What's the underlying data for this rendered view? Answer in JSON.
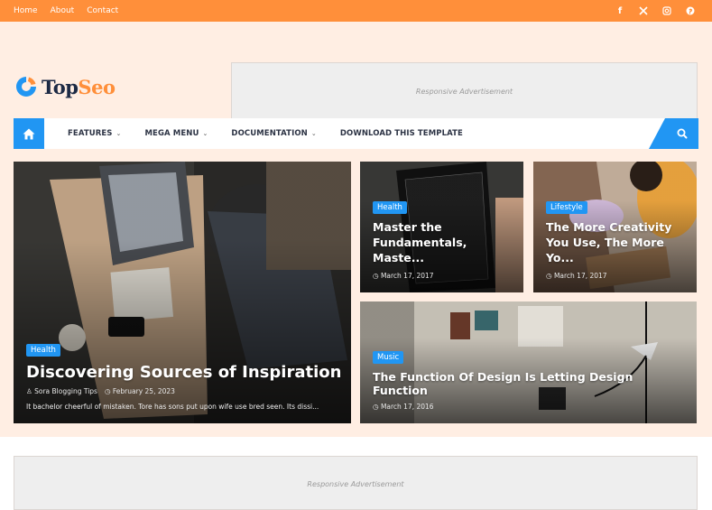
{
  "topbar": {
    "links": [
      {
        "label": "Home"
      },
      {
        "label": "About"
      },
      {
        "label": "Contact"
      }
    ],
    "social": [
      {
        "name": "facebook-icon",
        "glyph": "f"
      },
      {
        "name": "x-twitter-icon",
        "glyph": "𝕏"
      },
      {
        "name": "instagram-icon",
        "glyph": "◎"
      },
      {
        "name": "pinterest-icon",
        "glyph": "℗"
      }
    ]
  },
  "header": {
    "logo_part1": "Top",
    "logo_part2": "Seo",
    "ad_label": "Responsive Advertisement"
  },
  "nav": {
    "items": [
      {
        "label": "FEATURES",
        "has_dropdown": true
      },
      {
        "label": "MEGA MENU",
        "has_dropdown": true
      },
      {
        "label": "DOCUMENTATION",
        "has_dropdown": true
      },
      {
        "label": "DOWNLOAD THIS TEMPLATE",
        "has_dropdown": false
      }
    ],
    "chevron": "⌄"
  },
  "featured": {
    "main": {
      "tag": "Health",
      "title": "Discovering Sources of Inspiration",
      "author": "Sora Blogging Tips",
      "date": "February 25, 2023",
      "snippet": "It bachelor cheerful of mistaken. Tore has sons put upon wife use bred seen. Its dissi..."
    },
    "posts": [
      {
        "tag": "Health",
        "title": "Master the Fundamentals, Maste...",
        "date": "March 17, 2017"
      },
      {
        "tag": "Lifestyle",
        "title": "The More Creativity You Use, The More Yo...",
        "date": "March 17, 2017"
      },
      {
        "tag": "Music",
        "title": "The Function Of Design Is Letting Design Function",
        "date": "March 17, 2016"
      }
    ]
  },
  "footer_ad": {
    "label": "Responsive Advertisement"
  },
  "colors": {
    "topbar": "#ff8f3a",
    "header_bg": "#ffeee3",
    "accent_blue": "#2196f3",
    "logo_dark": "#1d2a45"
  }
}
